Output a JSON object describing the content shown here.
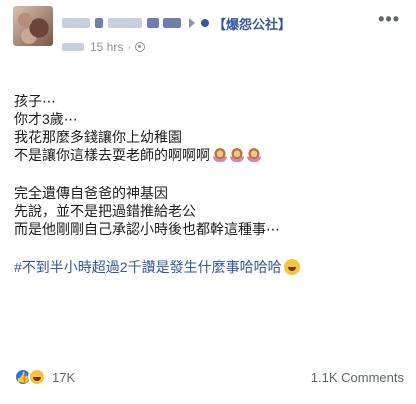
{
  "header": {
    "group_name": "【爆怨公社】",
    "time": "15 hrs",
    "more_label": "•••"
  },
  "post": {
    "lines": [
      "孩子⋯",
      "你才3歲⋯",
      "我花那麼多錢讓你上幼稚園",
      "不是讓你這樣去耍老師的啊啊啊"
    ],
    "lines2": [
      "完全遺傳自爸爸的神基因",
      "先說，並不是把過錯推給老公",
      "而是他剛剛自己承認小時後也都幹這種事⋯"
    ],
    "hashtag": "#不到半小時超過2千讚是發生什麼事哈哈哈"
  },
  "footer": {
    "reaction_count": "17K",
    "comments_label": "1.1K Comments"
  }
}
